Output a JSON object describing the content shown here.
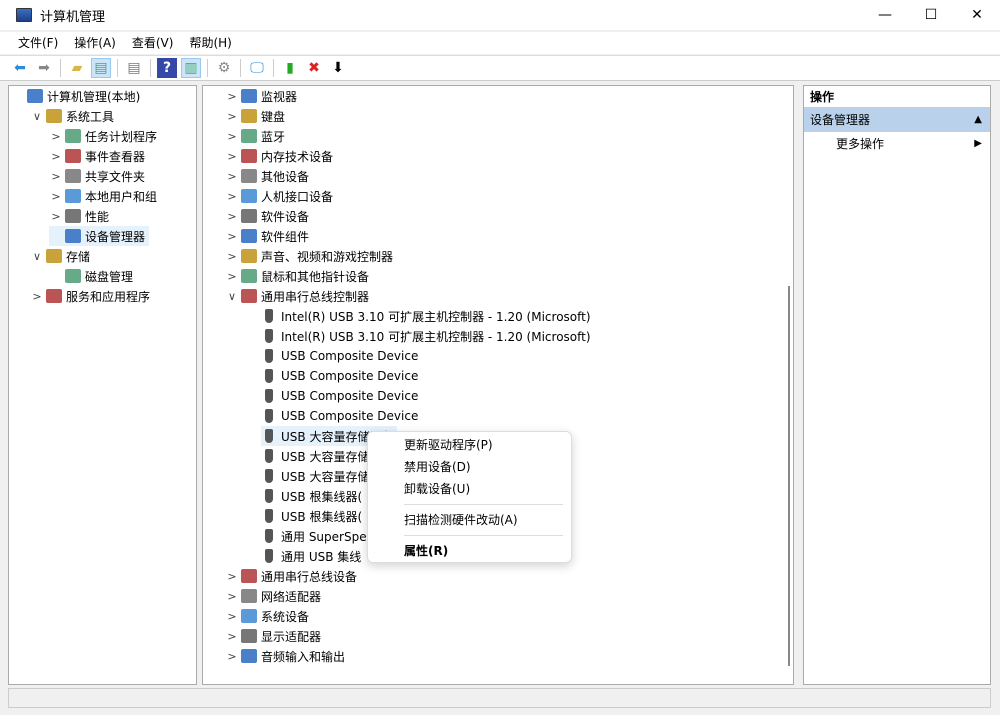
{
  "window": {
    "title": "计算机管理",
    "min": "—",
    "max": "☐",
    "close": "✕"
  },
  "menu": [
    "文件(F)",
    "操作(A)",
    "查看(V)",
    "帮助(H)"
  ],
  "toolbar": [
    "arrow-left-icon",
    "arrow-right-icon",
    "folder-up-icon",
    "show-hide-tree-icon",
    "properties-icon",
    "help-icon",
    "show-action-pane-icon",
    "update-driver-icon",
    "scan-hardware-icon",
    "enable-device-icon",
    "uninstall-device-icon",
    "disable-device-icon"
  ],
  "left_tree": [
    {
      "label": "计算机管理(本地)",
      "level": 0,
      "chev": ""
    },
    {
      "label": "系统工具",
      "level": 1,
      "chev": "∨"
    },
    {
      "label": "任务计划程序",
      "level": 2,
      "chev": ">"
    },
    {
      "label": "事件查看器",
      "level": 2,
      "chev": ">"
    },
    {
      "label": "共享文件夹",
      "level": 2,
      "chev": ">"
    },
    {
      "label": "本地用户和组",
      "level": 2,
      "chev": ">"
    },
    {
      "label": "性能",
      "level": 2,
      "chev": ">"
    },
    {
      "label": "设备管理器",
      "level": 2,
      "chev": "",
      "selected": true
    },
    {
      "label": "存储",
      "level": 1,
      "chev": "∨"
    },
    {
      "label": "磁盘管理",
      "level": 2,
      "chev": ""
    },
    {
      "label": "服务和应用程序",
      "level": 1,
      "chev": ">"
    }
  ],
  "device_tree": [
    {
      "label": "监视器",
      "child": false,
      "chev": ">"
    },
    {
      "label": "键盘",
      "child": false,
      "chev": ">"
    },
    {
      "label": "蓝牙",
      "child": false,
      "chev": ">"
    },
    {
      "label": "内存技术设备",
      "child": false,
      "chev": ">"
    },
    {
      "label": "其他设备",
      "child": false,
      "chev": ">"
    },
    {
      "label": "人机接口设备",
      "child": false,
      "chev": ">"
    },
    {
      "label": "软件设备",
      "child": false,
      "chev": ">"
    },
    {
      "label": "软件组件",
      "child": false,
      "chev": ">"
    },
    {
      "label": "声音、视频和游戏控制器",
      "child": false,
      "chev": ">"
    },
    {
      "label": "鼠标和其他指针设备",
      "child": false,
      "chev": ">"
    },
    {
      "label": "通用串行总线控制器",
      "child": false,
      "chev": "∨"
    },
    {
      "label": "Intel(R) USB 3.10 可扩展主机控制器 - 1.20 (Microsoft)",
      "child": true
    },
    {
      "label": "Intel(R) USB 3.10 可扩展主机控制器 - 1.20 (Microsoft)",
      "child": true
    },
    {
      "label": "USB Composite Device",
      "child": true
    },
    {
      "label": "USB Composite Device",
      "child": true
    },
    {
      "label": "USB Composite Device",
      "child": true
    },
    {
      "label": "USB Composite Device",
      "child": true
    },
    {
      "label": "USB 大容量存储设备",
      "child": true,
      "selected": true
    },
    {
      "label": "USB 大容量存储设备",
      "child": true
    },
    {
      "label": "USB 大容量存储设备",
      "child": true
    },
    {
      "label": "USB 根集线器(",
      "child": true
    },
    {
      "label": "USB 根集线器(",
      "child": true
    },
    {
      "label": "通用 SuperSpe",
      "child": true
    },
    {
      "label": "通用 USB 集线",
      "child": true
    },
    {
      "label": "通用串行总线设备",
      "child": false,
      "chev": ">"
    },
    {
      "label": "网络适配器",
      "child": false,
      "chev": ">"
    },
    {
      "label": "系统设备",
      "child": false,
      "chev": ">"
    },
    {
      "label": "显示适配器",
      "child": false,
      "chev": ">"
    },
    {
      "label": "音频输入和输出",
      "child": false,
      "chev": ">"
    }
  ],
  "actions": {
    "header": "操作",
    "section": "设备管理器",
    "section_arrow": "▲",
    "item": "更多操作",
    "item_arrow": "▶"
  },
  "context_menu": {
    "items": [
      "更新驱动程序(P)",
      "禁用设备(D)",
      "卸载设备(U)",
      "扫描检测硬件改动(A)",
      "属性(R)"
    ]
  }
}
